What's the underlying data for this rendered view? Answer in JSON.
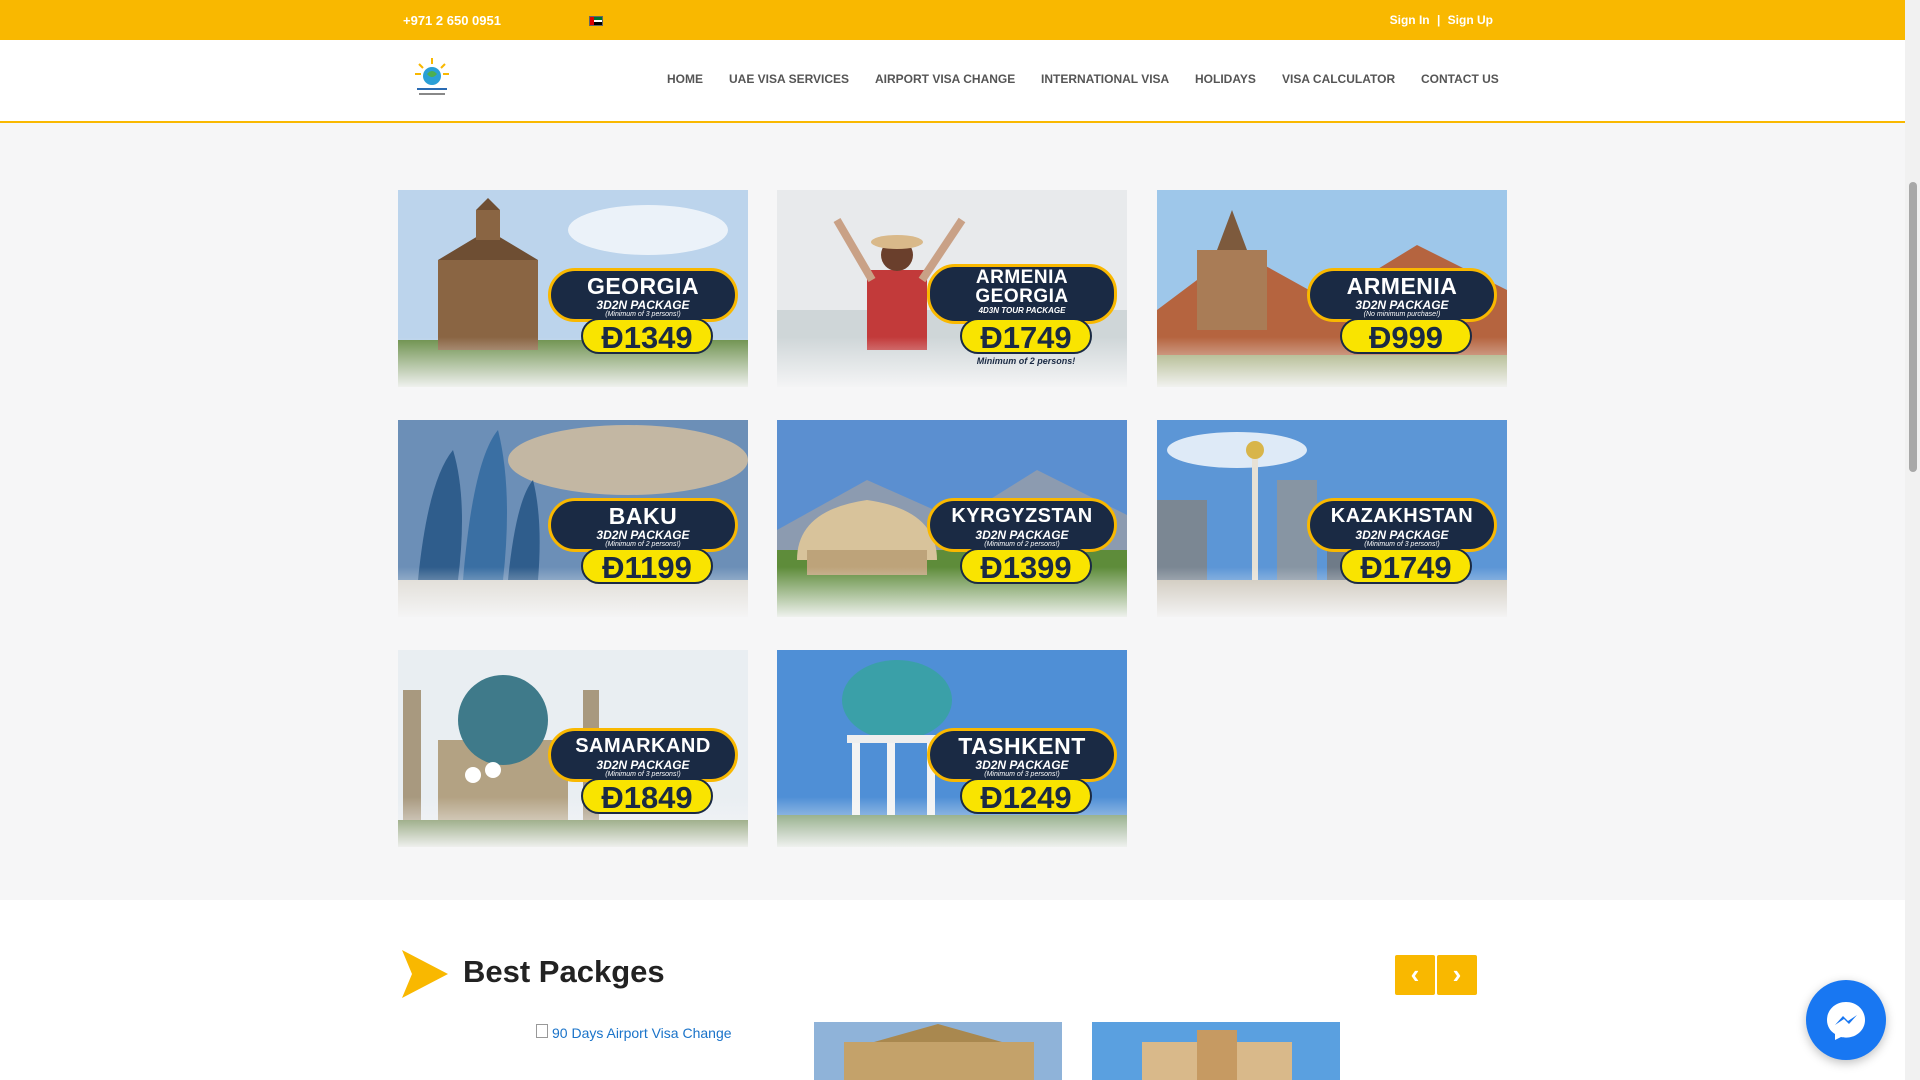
{
  "topbar": {
    "phone": "+971 2 650 0951",
    "flag_icon": "uae-flag-icon",
    "sign_in": "Sign In",
    "separator": "|",
    "sign_up": "Sign Up"
  },
  "nav": {
    "items": [
      "HOME",
      "UAE VISA SERVICES",
      "AIRPORT VISA CHANGE",
      "INTERNATIONAL VISA",
      "HOLIDAYS",
      "VISA CALCULATOR",
      "CONTACT US"
    ]
  },
  "packages": [
    {
      "place": "GEORGIA",
      "package": "3D2N PACKAGE",
      "note": "(Minimum of 3 persons!)",
      "price": "Đ1349",
      "price_note": ""
    },
    {
      "place": "ARMENIA\nGEORGIA",
      "package": "4D3N TOUR PACKAGE",
      "note": "",
      "price": "Đ1749",
      "price_note": "Minimum of 2 persons!"
    },
    {
      "place": "ARMENIA",
      "package": "3D2N PACKAGE",
      "note": "(No minimum purchase!)",
      "price": "Đ999",
      "price_note": ""
    },
    {
      "place": "BAKU",
      "package": "3D2N PACKAGE",
      "note": "(Minimum of 2 persons!)",
      "price": "Đ1199",
      "price_note": ""
    },
    {
      "place": "KYRGYZSTAN",
      "package": "3D2N PACKAGE",
      "note": "(Minimum of 2 persons!)",
      "price": "Đ1399",
      "price_note": ""
    },
    {
      "place": "KAZAKHSTAN",
      "package": "3D2N PACKAGE",
      "note": "(Minimum of 3 persons!)",
      "price": "Đ1749",
      "price_note": ""
    },
    {
      "place": "SAMARKAND",
      "package": "3D2N PACKAGE",
      "note": "(Minimum of 3 persons!)",
      "price": "Đ1849",
      "price_note": ""
    },
    {
      "place": "TASHKENT",
      "package": "3D2N PACKAGE",
      "note": "(Minimum of 3 persons!)",
      "price": "Đ1249",
      "price_note": ""
    }
  ],
  "best": {
    "title": "Best Packges",
    "prev_icon": "chevron-left-icon",
    "next_icon": "chevron-right-icon",
    "first_item_alt": "90 Days Airport Visa Change"
  },
  "colors": {
    "brand_yellow": "#f9b800",
    "pill_navy": "#1a2a44",
    "price_yellow": "#f9e400",
    "messenger_blue": "#1877f2"
  }
}
